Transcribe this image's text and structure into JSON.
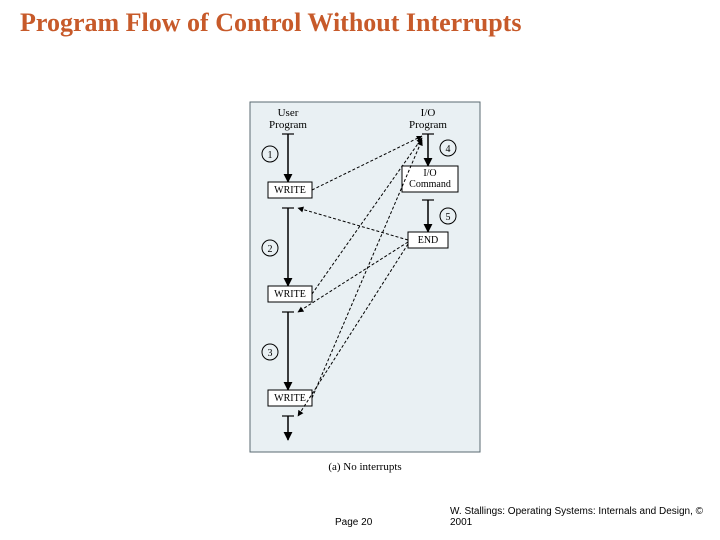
{
  "title": "Program Flow of Control Without Interrupts",
  "diagram": {
    "left_column_header1": "User",
    "left_column_header2": "Program",
    "right_column_header1": "I/O",
    "right_column_header2": "Program",
    "write_label": "WRITE",
    "io_cmd_label1": "I/O",
    "io_cmd_label2": "Command",
    "end_label": "END",
    "circle_1": "1",
    "circle_2": "2",
    "circle_3": "3",
    "circle_4": "4",
    "circle_5": "5",
    "caption": "(a) No interrupts"
  },
  "footer": {
    "page": "Page 20",
    "credit": "W. Stallings: Operating Systems: Internals and Design, © 2001"
  },
  "chart_data": {
    "type": "diagram",
    "description": "Control-flow diagram: User Program column with three WRITE calls (segments 1,2,3); I/O Program column with step 4 leading to I/O Command, step 5 leading to END. Dashed arrows show transfers between each WRITE and the I/O Program top/END.",
    "left_column": {
      "label": "User Program",
      "segments": [
        1,
        2,
        3
      ],
      "boxes": [
        "WRITE",
        "WRITE",
        "WRITE"
      ]
    },
    "right_column": {
      "label": "I/O Program",
      "steps": [
        {
          "id": 4,
          "to": "I/O Command"
        },
        {
          "id": 5,
          "to": "END"
        }
      ]
    },
    "caption": "(a) No interrupts"
  }
}
